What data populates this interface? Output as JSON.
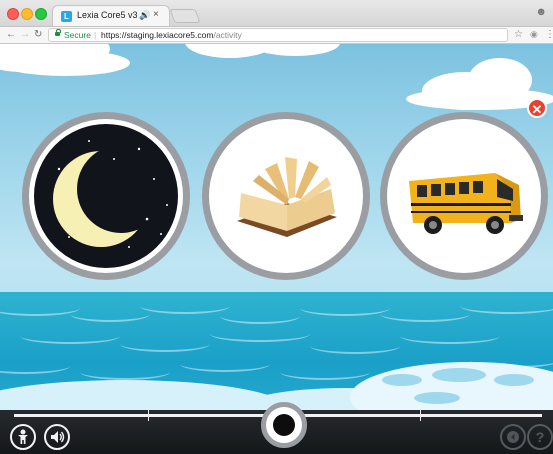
{
  "browser": {
    "tab_title": "Lexia Core5 v3",
    "tab_audio_glyph": "🔊",
    "tab_close_glyph": "×",
    "tab_favicon_glyph": "L",
    "secure_label": "Secure",
    "url_host": "https://staging.lexiacore5.com",
    "url_path": "/activity",
    "icons": [
      "back-icon",
      "forward-icon",
      "reload-icon",
      "lock-icon",
      "star-icon",
      "extension-icon",
      "menu-icon",
      "profile-icon"
    ]
  },
  "activity": {
    "choices": [
      {
        "name": "moon",
        "icon": "crescent-moon-icon"
      },
      {
        "name": "book",
        "icon": "open-book-icon"
      },
      {
        "name": "bus",
        "icon": "school-bus-icon"
      }
    ],
    "close_glyph": "✕",
    "colors": {
      "sky": "#a3d8ec",
      "sea": "#1aa0c8",
      "close": "#e9412f",
      "frame": "#9a9ea2",
      "toolbar": "#1b1f23"
    }
  },
  "toolbar": {
    "icons": [
      "help-person-icon",
      "speaker-icon",
      "record-icon",
      "back-sound-icon",
      "question-icon"
    ]
  }
}
